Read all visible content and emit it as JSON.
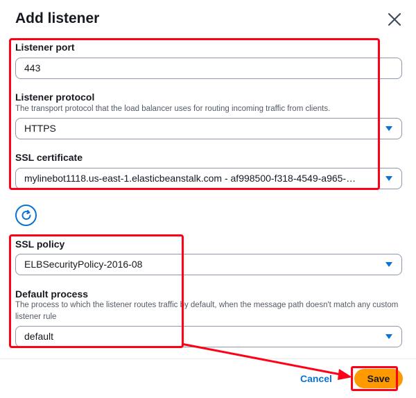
{
  "modal": {
    "title": "Add listener"
  },
  "fields": {
    "listener_port": {
      "label": "Listener port",
      "value": "443"
    },
    "listener_protocol": {
      "label": "Listener protocol",
      "description": "The transport protocol that the load balancer uses for routing incoming traffic from clients.",
      "value": "HTTPS"
    },
    "ssl_certificate": {
      "label": "SSL certificate",
      "value": "mylinebot1118.us-east-1.elasticbeanstalk.com - af998500-f318-4549-a965-…"
    },
    "ssl_policy": {
      "label": "SSL policy",
      "value": "ELBSecurityPolicy-2016-08"
    },
    "default_process": {
      "label": "Default process",
      "description": "The process to which the listener routes traffic by default, when the message path doesn't match any custom listener rule",
      "value": "default"
    }
  },
  "footer": {
    "cancel_label": "Cancel",
    "save_label": "Save"
  },
  "colors": {
    "accent": "#0972d3",
    "primary_button": "#ff9900",
    "annotation": "#ff0017"
  },
  "icons": {
    "close": "close-icon",
    "refresh": "refresh-icon",
    "dropdown": "caret-down-icon"
  }
}
